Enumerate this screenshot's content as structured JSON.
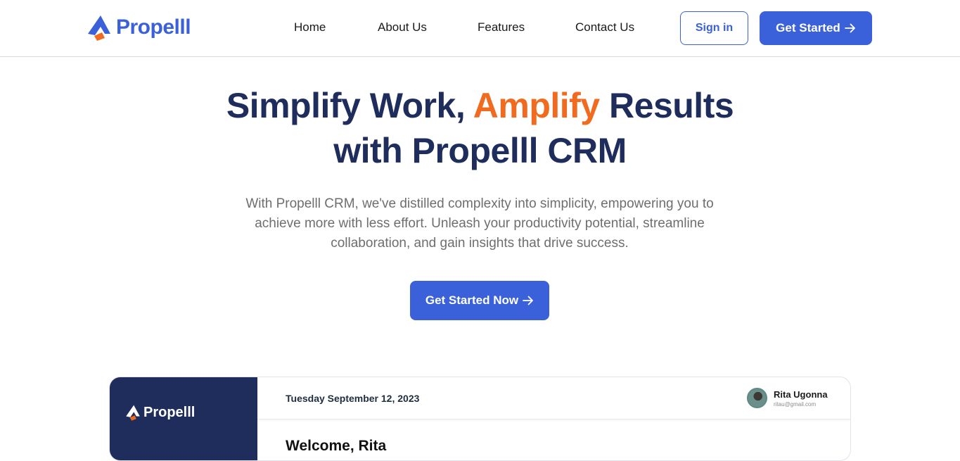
{
  "brand": {
    "name": "Propelll",
    "primary_color": "#3a61d9",
    "accent_color": "#f06a1f",
    "dark_color": "#1f2d5c"
  },
  "nav": {
    "links": [
      "Home",
      "About Us",
      "Features",
      "Contact Us"
    ],
    "signin_label": "Sign in",
    "get_started_label": "Get Started",
    "arrow_icon": "arrow-right-icon"
  },
  "hero": {
    "title_part1": "Simplify Work",
    "title_comma": ",",
    "title_accent": "Amplify",
    "title_part2": "Results",
    "title_line2": "with Propelll CRM",
    "subtitle": "With Propelll CRM, we've distilled complexity into simplicity, empowering you to achieve more with less effort. Unleash your productivity potential, streamline collaboration, and gain insights that drive success.",
    "cta_label": "Get Started Now"
  },
  "dashboard_preview": {
    "sidebar_brand": "Propelll",
    "date": "Tuesday September 12, 2023",
    "user_name": "Rita Ugonna",
    "user_email": "ritau@gmail.com",
    "welcome": "Welcome, Rita"
  }
}
